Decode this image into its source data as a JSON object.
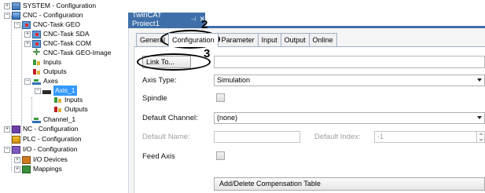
{
  "tree": {
    "items": [
      {
        "label": "SYSTEM - Configuration",
        "expander": "+"
      },
      {
        "label": "CNC - Configuration",
        "expander": "−"
      },
      {
        "label": "CNC-Task GEO",
        "expander": "−"
      },
      {
        "label": "CNC-Task SDA",
        "expander": "+"
      },
      {
        "label": "CNC-Task COM",
        "expander": "+"
      },
      {
        "label": "CNC-Task GEO-Image",
        "expander": ""
      },
      {
        "label": "Inputs",
        "expander": ""
      },
      {
        "label": "Outputs",
        "expander": ""
      },
      {
        "label": "Axes",
        "expander": "−"
      },
      {
        "label": "Axis_1",
        "expander": "−"
      },
      {
        "label": "Inputs",
        "expander": ""
      },
      {
        "label": "Outputs",
        "expander": ""
      },
      {
        "label": "Channel_1",
        "expander": ""
      },
      {
        "label": "NC - Configuration",
        "expander": "+"
      },
      {
        "label": "PLC - Configuration",
        "expander": ""
      },
      {
        "label": "I/O - Configuration",
        "expander": "−"
      },
      {
        "label": "I/O Devices",
        "expander": "+"
      },
      {
        "label": "Mappings",
        "expander": "+"
      }
    ]
  },
  "document_tab": {
    "title": "TwinCAT Project1",
    "pin": "⊣",
    "close": "✕"
  },
  "subtabs": [
    "General",
    "Configuration",
    "Parameter",
    "Input",
    "Output",
    "Online"
  ],
  "form": {
    "link_button": "Link To...",
    "axis_type_label": "Axis Type:",
    "axis_type_value": "Simulation",
    "spindle_label": "Spindle",
    "default_channel_label": "Default Channel:",
    "default_channel_value": "(none)",
    "default_name_label": "Default Name:",
    "default_index_label": "Default Index:",
    "default_index_value": "-1",
    "feed_axis_label": "Feed Axis",
    "compensation_button": "Add/Delete Compensation Table"
  },
  "annotations": {
    "step2": "2",
    "step3": "3"
  }
}
